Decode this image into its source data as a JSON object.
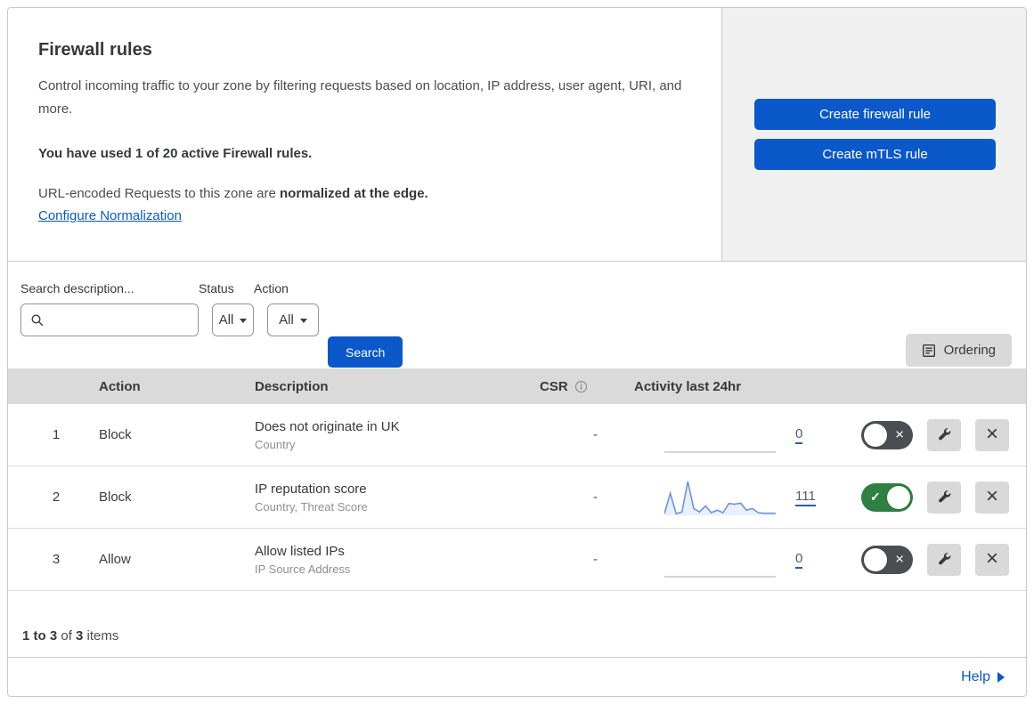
{
  "header": {
    "title": "Firewall rules",
    "description": "Control incoming traffic to your zone by filtering requests based on location, IP address, user agent, URI, and more.",
    "usage": "You have used 1 of 20 active Firewall rules.",
    "normalization_prefix": "URL-encoded Requests to this zone are ",
    "normalization_bold": "normalized at the edge.",
    "normalization_link": "Configure Normalization",
    "create_firewall_button": "Create firewall rule",
    "create_mtls_button": "Create mTLS rule"
  },
  "filters": {
    "search_label": "Search description...",
    "search_value": "",
    "status_label": "Status",
    "status_value": "All",
    "action_label": "Action",
    "action_value": "All",
    "search_button": "Search",
    "ordering_button": "Ordering"
  },
  "table": {
    "columns": {
      "action": "Action",
      "description": "Description",
      "csr": "CSR",
      "activity": "Activity last 24hr"
    },
    "rows": [
      {
        "number": "1",
        "action": "Block",
        "description": "Does not originate in UK",
        "fields": "Country",
        "csr": "-",
        "count": "0",
        "enabled": false,
        "sparkline": []
      },
      {
        "number": "2",
        "action": "Block",
        "description": "IP reputation score",
        "fields": "Country, Threat Score",
        "csr": "-",
        "count": "111",
        "enabled": true,
        "sparkline": [
          5,
          65,
          5,
          10,
          100,
          20,
          10,
          28,
          8,
          15,
          8,
          35,
          33,
          36,
          15,
          20,
          8,
          6,
          6,
          6
        ]
      },
      {
        "number": "3",
        "action": "Allow",
        "description": "Allow listed IPs",
        "fields": "IP Source Address",
        "csr": "-",
        "count": "0",
        "enabled": false,
        "sparkline": []
      }
    ]
  },
  "footer": {
    "summary_range": "1 to 3",
    "summary_of": " of ",
    "summary_total": "3",
    "summary_items": " items",
    "help_label": "Help"
  },
  "icons": {
    "check": "✓",
    "cross": "×"
  },
  "colors": {
    "accent_blue": "#0a58ca",
    "link_blue": "#0a58ca",
    "toggle_on_green": "#2e8043",
    "toggle_off_gray": "#4b4e53",
    "sparkline_blue": "#6b94e4",
    "count_underline_blue": "#2060b0",
    "panel_gray": "#f0f0f0",
    "table_header_gray": "#dadada",
    "button_gray": "#d9d9d9"
  }
}
